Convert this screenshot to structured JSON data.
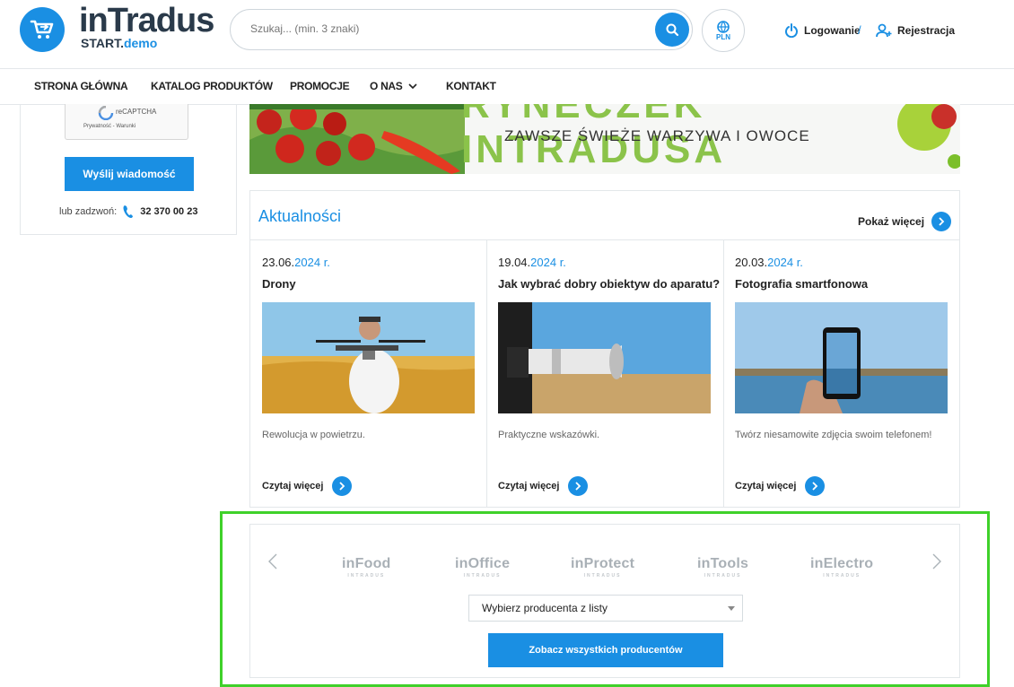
{
  "header": {
    "logo_main": "inTradus",
    "logo_sub_a": "START.",
    "logo_sub_b": "demo",
    "search_placeholder": "Szukaj... (min. 3 znaki)",
    "currency": "PLN",
    "login_label": "Logowanie",
    "separator": "/",
    "register_label": "Rejestracja"
  },
  "nav": [
    {
      "label": "STRONA GŁÓWNA"
    },
    {
      "label": "KATALOG PRODUKTÓW"
    },
    {
      "label": "PROMOCJE"
    },
    {
      "label": "O NAS"
    },
    {
      "label": "KONTAKT"
    }
  ],
  "left_panel": {
    "recaptcha_title": "reCAPTCHA",
    "recaptcha_links": "Prywatność - Warunki",
    "send_button": "Wyślij wiadomość",
    "call_label": "lub zadzwoń:",
    "phone": "32 370 00 23"
  },
  "banner": {
    "headline": "RYNECZEK INTRADUSA",
    "slogan": "ZAWSZE ŚWIEŻE WARZYWA I OWOCE"
  },
  "news": {
    "title": "Aktualności",
    "more_label": "Pokaż więcej",
    "items": [
      {
        "date_prefix": "23.06.",
        "year": "2024",
        "date_suffix": " r.",
        "title": "Drony",
        "desc": "Rewolucja w powietrzu.",
        "read": "Czytaj więcej"
      },
      {
        "date_prefix": "19.04.",
        "year": "2024",
        "date_suffix": " r.",
        "title": "Jak wybrać dobry obiektyw do aparatu?",
        "desc": "Praktyczne wskazówki.",
        "read": "Czytaj więcej"
      },
      {
        "date_prefix": "20.03.",
        "year": "2024",
        "date_suffix": " r.",
        "title": "Fotografia smartfonowa",
        "desc": "Twórz niesamowite zdjęcia swoim telefonem!",
        "read": "Czytaj więcej"
      }
    ]
  },
  "producers": {
    "brands": [
      {
        "name": "inFood"
      },
      {
        "name": "inOffice"
      },
      {
        "name": "inProtect"
      },
      {
        "name": "inTools"
      },
      {
        "name": "inElectro"
      }
    ],
    "brand_tagline": "INTRADUS",
    "select_label": "Wybierz producenta z listy",
    "all_button": "Zobacz wszystkich producentów"
  },
  "colors": {
    "accent": "#1a8fe3",
    "highlight": "#3fd12a"
  }
}
